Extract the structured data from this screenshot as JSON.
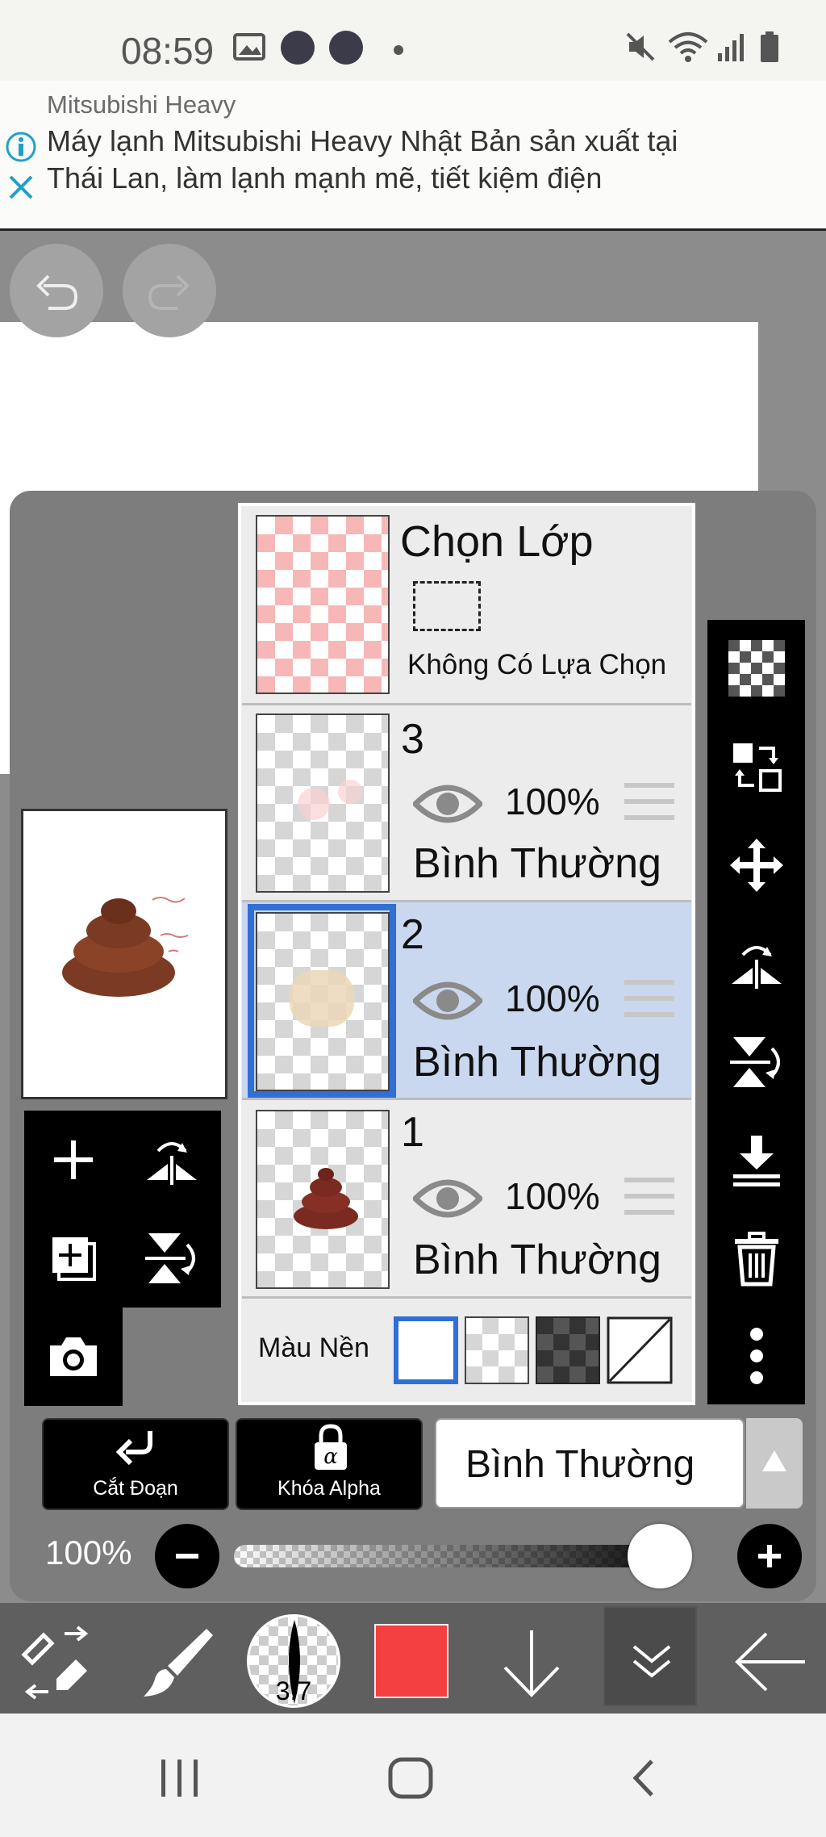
{
  "status_bar": {
    "time": "08:59"
  },
  "ad": {
    "source": "Mitsubishi Heavy",
    "line1": "Máy lạnh Mitsubishi Heavy Nhật Bản sản xuất tại",
    "line2": "Thái Lan, làm lạnh mạnh mẽ, tiết kiệm điện"
  },
  "selection_layer": {
    "title": "Chọn Lớp",
    "status": "Không Có Lựa Chọn"
  },
  "layers": [
    {
      "number": "3",
      "opacity": "100%",
      "blend": "Bình Thường",
      "selected": false
    },
    {
      "number": "2",
      "opacity": "100%",
      "blend": "Bình Thường",
      "selected": true
    },
    {
      "number": "1",
      "opacity": "100%",
      "blend": "Bình Thường",
      "selected": false
    }
  ],
  "background": {
    "label": "Màu Nền"
  },
  "buttons": {
    "clip": "Cắt Đoạn",
    "alpha_lock": "Khóa Alpha"
  },
  "blend_mode": {
    "value": "Bình Thường"
  },
  "opacity_slider": {
    "label": "100%",
    "value_fraction": 1.0
  },
  "brush": {
    "size": "3.7"
  },
  "colors": {
    "accent": "#2f6fd6",
    "primary_color": "#f44040",
    "selected_row": "#c9d7ef"
  }
}
